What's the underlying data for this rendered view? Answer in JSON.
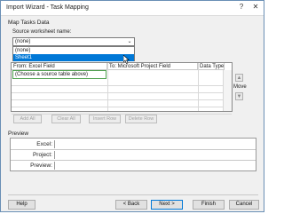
{
  "window": {
    "title": "Import Wizard - Task Mapping",
    "help_glyph": "?",
    "close_glyph": "✕"
  },
  "section": {
    "heading": "Map Tasks Data",
    "source_label": "Source worksheet name:"
  },
  "combo": {
    "value": "(none)",
    "arrow": "⌄"
  },
  "dropdown": {
    "options": [
      "(none)",
      "Sheet1"
    ],
    "selected_index": 1
  },
  "grid": {
    "columns": [
      "From: Excel Field",
      "To: Microsoft Project Field",
      "Data Type"
    ],
    "first_cell": "(Choose a source table above)",
    "row_count": 6
  },
  "move": {
    "up": "▲",
    "label": "Move",
    "down": "▼"
  },
  "grid_buttons": {
    "add_all": "Add All",
    "clear_all": "Clear All",
    "insert_row": "Insert Row",
    "delete_row": "Delete Row"
  },
  "preview": {
    "heading": "Preview",
    "rows": [
      "Excel:",
      "Project:",
      "Preview:"
    ]
  },
  "footer": {
    "help": "Help",
    "back": "< Back",
    "next": "Next >",
    "finish": "Finish",
    "cancel": "Cancel"
  }
}
